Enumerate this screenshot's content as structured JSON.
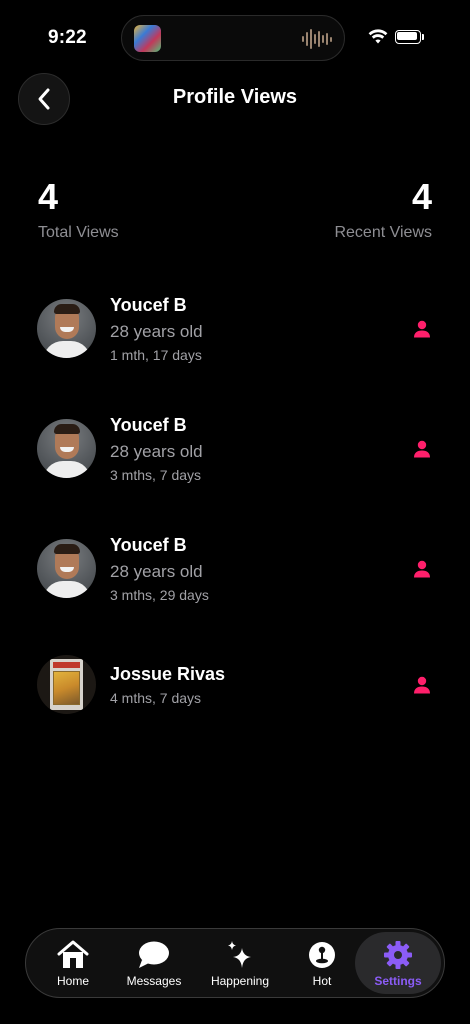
{
  "status_bar": {
    "time": "9:22"
  },
  "header": {
    "title": "Profile Views"
  },
  "stats": {
    "total_views_value": "4",
    "total_views_label": "Total Views",
    "recent_views_value": "4",
    "recent_views_label": "Recent Views"
  },
  "viewers": [
    {
      "name": "Youcef B",
      "age": "28 years old",
      "time": "1 mth, 17 days",
      "avatar": "person-photo"
    },
    {
      "name": "Youcef B",
      "age": "28 years old",
      "time": "3 mths, 7 days",
      "avatar": "person-photo"
    },
    {
      "name": "Youcef B",
      "age": "28 years old",
      "time": "3 mths, 29 days",
      "avatar": "person-photo"
    },
    {
      "name": "Jossue Rivas",
      "time": "4 mths, 7 days",
      "avatar": "trading-card-photo"
    }
  ],
  "tab_bar": {
    "tabs": [
      {
        "label": "Home",
        "icon": "house-icon"
      },
      {
        "label": "Messages",
        "icon": "chat-bubble-icon"
      },
      {
        "label": "Happening",
        "icon": "sparkles-icon"
      },
      {
        "label": "Hot",
        "icon": "joystick-icon"
      },
      {
        "label": "Settings",
        "icon": "gear-icon",
        "active": true
      }
    ]
  },
  "colors": {
    "background": "#000000",
    "accent_pink": "#ff1f6b",
    "accent_purple": "#8b5cf6",
    "secondary_text": "#a1a1a6"
  }
}
